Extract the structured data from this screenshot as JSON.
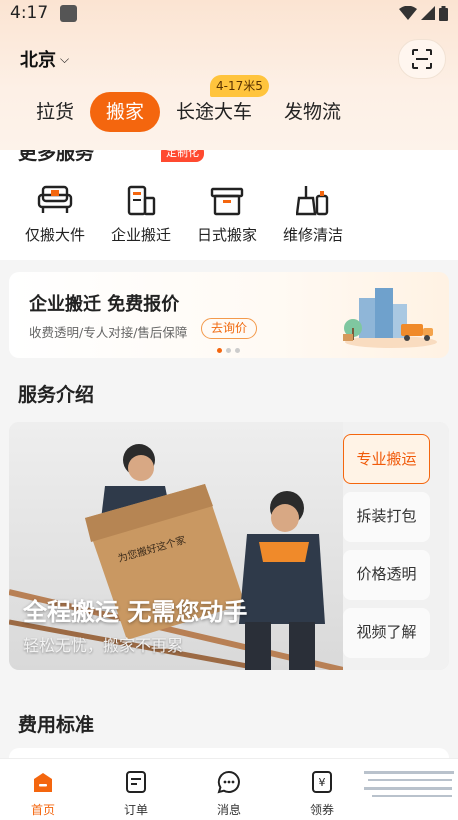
{
  "status_bar": {
    "time": "4:17"
  },
  "header": {
    "city": "北京",
    "tabs": [
      {
        "label": "拉货"
      },
      {
        "label": "搬家"
      },
      {
        "label": "长途大车"
      },
      {
        "label": "发物流"
      }
    ],
    "active_tab": "搬家",
    "tab_badge": "4-17米5"
  },
  "more_services": {
    "title": "更多服务",
    "items": [
      {
        "label": "仅搬大件",
        "icon": "sofa-icon"
      },
      {
        "label": "企业搬迁",
        "icon": "building-icon"
      },
      {
        "label": "日式搬家",
        "icon": "box-icon"
      },
      {
        "label": "维修清洁",
        "icon": "cleaning-icon"
      }
    ],
    "custom_badge": "定制化"
  },
  "banner": {
    "title": "企业搬迁 免费报价",
    "subtitle": "收费透明/专人对接/售后保障",
    "button": "去询价"
  },
  "service_intro": {
    "title": "服务介绍",
    "headline": "全程搬运 无需您动手",
    "subline": "轻松无忧，搬家不再累",
    "box_text": "为您搬好这个家",
    "options": [
      "专业搬运",
      "拆装打包",
      "价格透明",
      "视频了解"
    ],
    "active_option": "专业搬运"
  },
  "fee": {
    "title": "费用标准"
  },
  "bottom_nav": {
    "items": [
      {
        "label": "首页",
        "icon": "home-icon"
      },
      {
        "label": "订单",
        "icon": "order-icon"
      },
      {
        "label": "消息",
        "icon": "message-icon"
      },
      {
        "label": "领券",
        "icon": "coupon-icon"
      }
    ],
    "active": "首页"
  },
  "colors": {
    "accent": "#f4660e",
    "badge_yellow": "#ffc43d",
    "badge_red": "#ff4a30"
  }
}
